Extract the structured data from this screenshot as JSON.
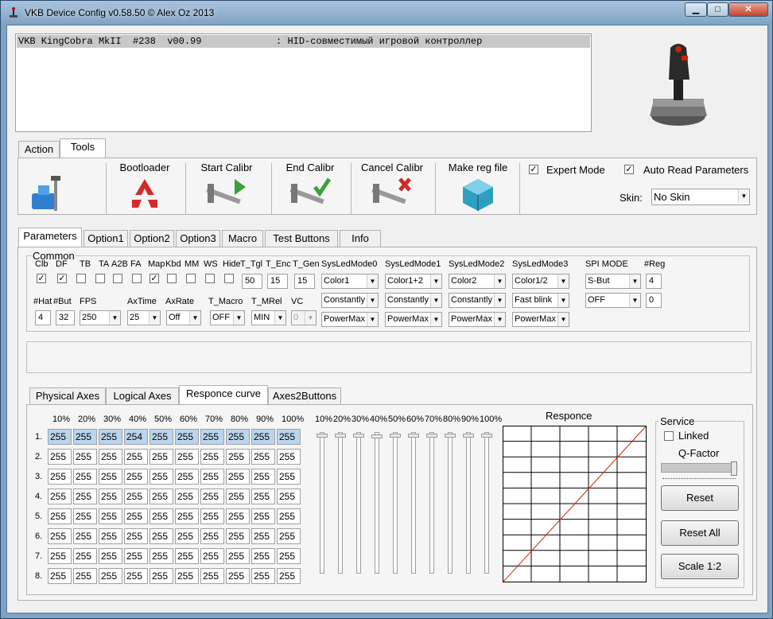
{
  "window": {
    "title": "VKB Device Config v0.58.50 © Alex Oz 2013",
    "min": "▁",
    "max": "□",
    "close": "✕"
  },
  "device": {
    "line": "VKB KingCobra MkII  #238  v00.99             : HID-совместимый игровой контроллер"
  },
  "main_tabs": [
    "Action",
    "Tools"
  ],
  "tools": {
    "bootloader": "Bootloader",
    "start_calibr": "Start Calibr",
    "end_calibr": "End Calibr",
    "cancel_calibr": "Cancel Calibr",
    "make_reg_file": "Make reg file",
    "expert_mode": "Expert Mode",
    "auto_read": "Auto Read Parameters",
    "skin_label": "Skin:",
    "skin_value": "No Skin"
  },
  "param_tabs": [
    "Parameters",
    "Option1",
    "Option2",
    "Option3",
    "Macro",
    "Test Buttons",
    "Info"
  ],
  "common": {
    "title": "Common",
    "check_labels": [
      "Clb",
      "DF",
      "TB",
      "TA",
      "A2B",
      "FA",
      "Map",
      "Kbd",
      "MM",
      "WS",
      "Hide"
    ],
    "check_states": [
      true,
      true,
      false,
      false,
      false,
      false,
      true,
      false,
      false,
      false,
      false
    ],
    "t_tgl_label": "T_Tgl",
    "t_tgl": "50",
    "t_enc_label": "T_Enc",
    "t_enc": "15",
    "t_gen_label": "T_Gen",
    "t_gen": "15",
    "sysled_labels": [
      "SysLedMode0",
      "SysLedMode1",
      "SysLedMode2",
      "SysLedMode3"
    ],
    "sysled_row1": [
      "Color1",
      "Color1+2",
      "Color2",
      "Color1/2"
    ],
    "sysled_row2": [
      "Constantly",
      "Constantly",
      "Constantly",
      "Fast blink"
    ],
    "sysled_row3": [
      "PowerMax",
      "PowerMax",
      "PowerMax",
      "PowerMax"
    ],
    "spi_label": "SPI MODE",
    "spi1": "S-But",
    "spi2": "OFF",
    "reg_label": "#Reg",
    "reg1": "4",
    "reg2": "0",
    "hat_label": "#Hat",
    "hat": "4",
    "but_label": "#But",
    "but": "32",
    "fps_label": "FPS",
    "fps": "250",
    "axtime_label": "AxTime",
    "axtime": "25",
    "axrate_label": "AxRate",
    "axrate": "Off",
    "tmacro_label": "T_Macro",
    "tmacro": "OFF",
    "tmrel_label": "T_MRel",
    "tmrel": "MIN",
    "vc_label": "VC",
    "vc": "0"
  },
  "axes_tabs": [
    "Physical Axes",
    "Logical Axes",
    "Responce curve",
    "Axes2Buttons"
  ],
  "curve": {
    "percent_headers": [
      "10%",
      "20%",
      "30%",
      "40%",
      "50%",
      "60%",
      "70%",
      "80%",
      "90%",
      "100%"
    ],
    "row_labels": [
      "1.",
      "2.",
      "3.",
      "4.",
      "5.",
      "6.",
      "7.",
      "8."
    ],
    "rows": [
      [
        "255",
        "255",
        "255",
        "254",
        "255",
        "255",
        "255",
        "255",
        "255",
        "255"
      ],
      [
        "255",
        "255",
        "255",
        "255",
        "255",
        "255",
        "255",
        "255",
        "255",
        "255"
      ],
      [
        "255",
        "255",
        "255",
        "255",
        "255",
        "255",
        "255",
        "255",
        "255",
        "255"
      ],
      [
        "255",
        "255",
        "255",
        "255",
        "255",
        "255",
        "255",
        "255",
        "255",
        "255"
      ],
      [
        "255",
        "255",
        "255",
        "255",
        "255",
        "255",
        "255",
        "255",
        "255",
        "255"
      ],
      [
        "255",
        "255",
        "255",
        "255",
        "255",
        "255",
        "255",
        "255",
        "255",
        "255"
      ],
      [
        "255",
        "255",
        "255",
        "255",
        "255",
        "255",
        "255",
        "255",
        "255",
        "255"
      ],
      [
        "255",
        "255",
        "255",
        "255",
        "255",
        "255",
        "255",
        "255",
        "255",
        "255"
      ]
    ],
    "slider_headers": [
      "10%",
      "20%",
      "30%",
      "40%",
      "50%",
      "60%",
      "70%",
      "80%",
      "90%",
      "100%"
    ],
    "slider_values": [
      255,
      255,
      255,
      254,
      255,
      255,
      255,
      255,
      255,
      255
    ],
    "slider_max": 255,
    "graph_title": "Responce",
    "line_color": "#cc2200"
  },
  "service": {
    "title": "Service",
    "linked": "Linked",
    "qfactor": "Q-Factor",
    "reset": "Reset",
    "reset_all": "Reset All",
    "scale": "Scale 1:2"
  }
}
